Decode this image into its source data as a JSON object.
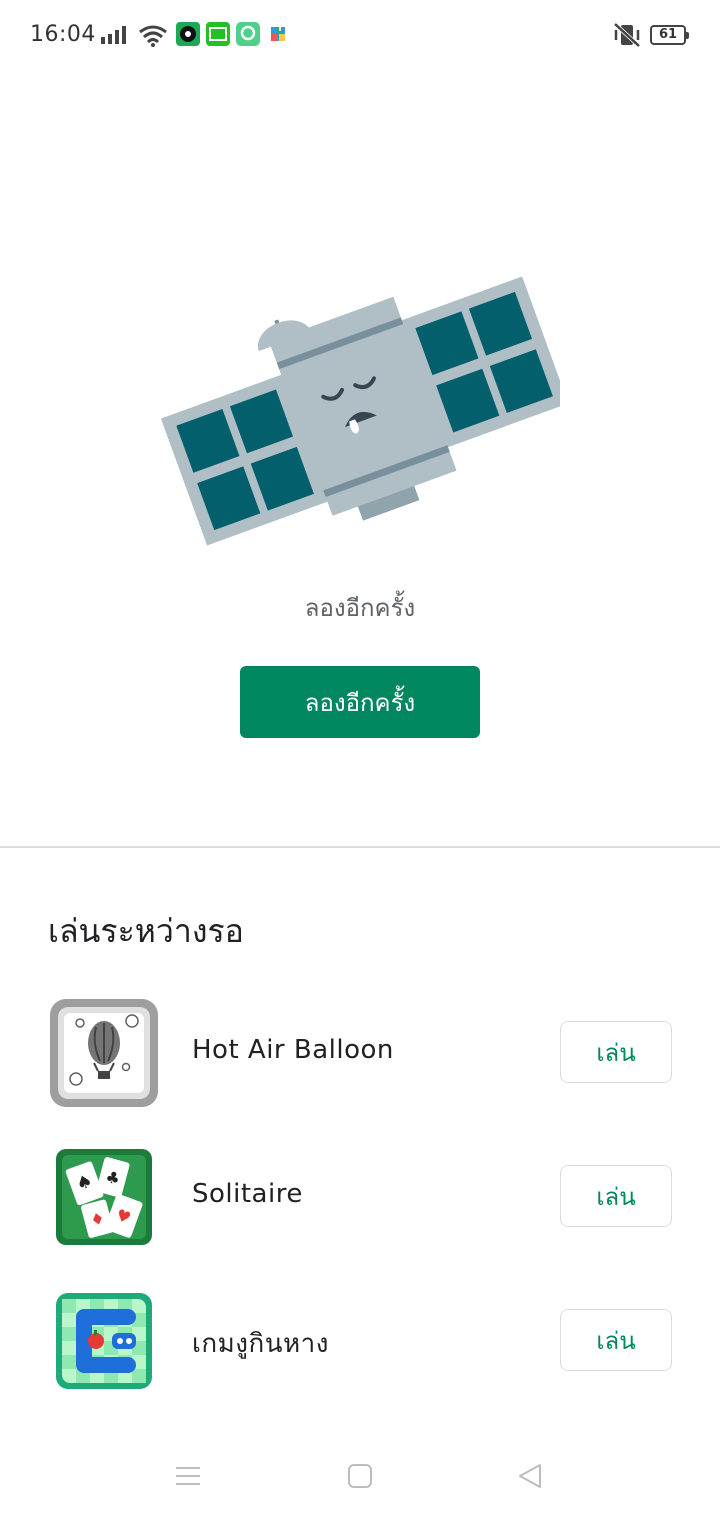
{
  "status_bar": {
    "time": "16:04",
    "battery": "61",
    "icons": [
      "signal-icon",
      "wifi-icon",
      "music-app-icon",
      "iqiyi-app-icon",
      "chat-app-icon",
      "puzzle-app-icon",
      "muted-vibrate-icon",
      "battery-icon"
    ]
  },
  "error": {
    "message": "ลองอีกครั้ง",
    "retry_label": "ลองอีกครั้ง"
  },
  "games_section": {
    "title": "เล่นระหว่างรอ",
    "items": [
      {
        "name": "Hot Air Balloon",
        "play_label": "เล่น",
        "icon": "hot-air-balloon-icon"
      },
      {
        "name": "Solitaire",
        "play_label": "เล่น",
        "icon": "solitaire-icon"
      },
      {
        "name": "เกมงูกินหาง",
        "play_label": "เล่น",
        "icon": "snake-game-icon"
      }
    ]
  },
  "colors": {
    "accent": "#01875f",
    "panel": "#035f6b",
    "satellite_body": "#b0bec5"
  }
}
